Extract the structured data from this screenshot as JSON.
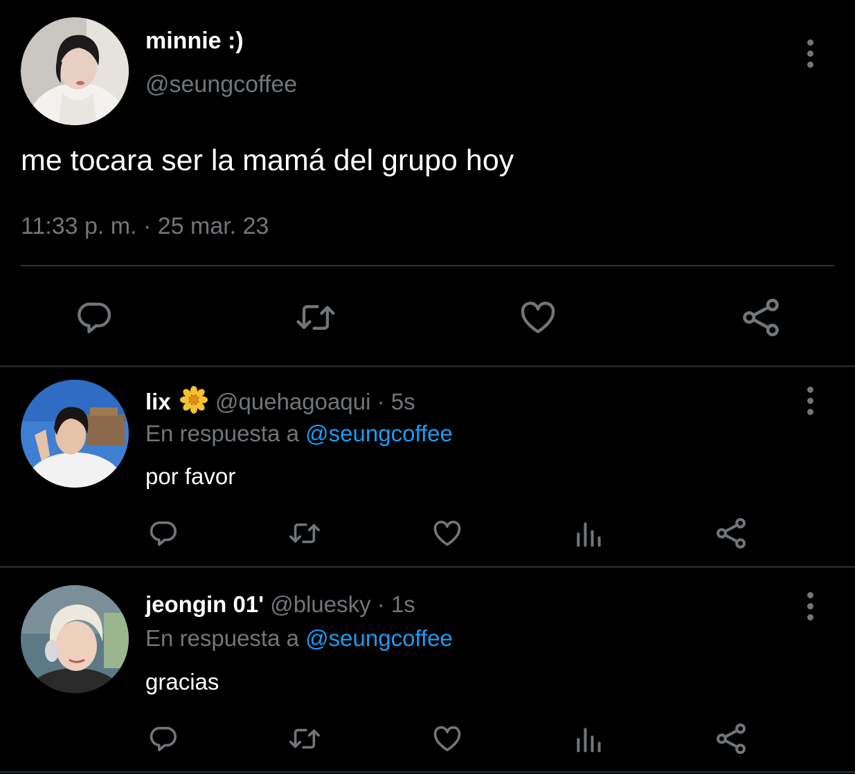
{
  "main_tweet": {
    "name": "minnie :)",
    "handle": "@seungcoffee",
    "text": "me tocara ser la mamá del grupo hoy",
    "timestamp": "11:33 p. m. · 25 mar. 23",
    "actions": [
      "reply-icon",
      "retweet-icon",
      "like-icon",
      "share-icon"
    ]
  },
  "replies": [
    {
      "name": "lix",
      "emoji": "🌼",
      "handle": "@quehagoaqui",
      "time": "· 5s",
      "reply_prefix": "En respuesta a",
      "mention": "@seungcoffee",
      "text": "por favor"
    },
    {
      "name": "jeongin 01'",
      "handle": "@bluesky",
      "time": "· 1s",
      "reply_prefix": "En respuesta a",
      "mention": "@seungcoffee",
      "text": "gracias"
    }
  ],
  "colors": {
    "background": "#000000",
    "secondary_text": "#71767b",
    "mention": "#1d9bf0",
    "icon": "#71767b",
    "flower": "#f4c430"
  }
}
